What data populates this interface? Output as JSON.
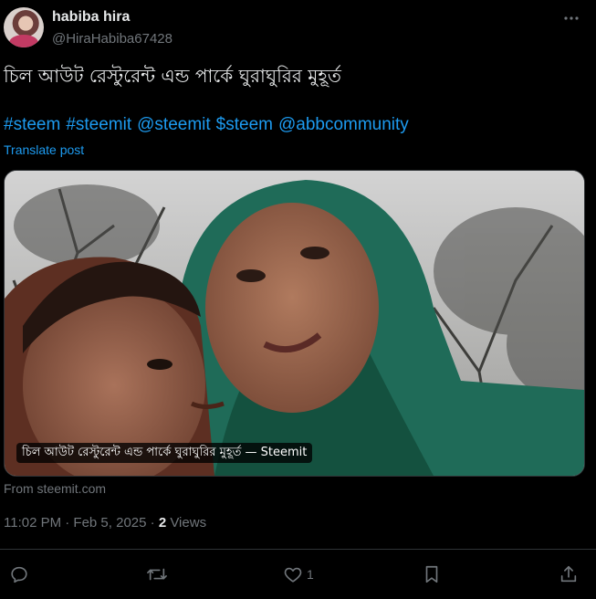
{
  "author": {
    "display_name": "habiba hira",
    "handle": "@HiraHabiba67428"
  },
  "post": {
    "text": "চিল আউট রেস্টুরেন্ট এন্ড পার্কে ঘুরাঘুরির মুহূর্ত",
    "tags": [
      "#steem",
      "#steemit",
      "@steemit",
      "$steem",
      "@abbcommunity"
    ],
    "translate_label": "Translate post"
  },
  "card": {
    "caption": "চিল আউট রেস্টুরেন্ট এন্ড পার্কে ঘুরাঘুরির মুহূর্ত — Steemit",
    "source": "From steemit.com"
  },
  "meta": {
    "timestamp": "11:02 PM · Feb 5, 2025 · ",
    "views_count": "2",
    "views_label": " Views"
  },
  "actions": {
    "reply_count": "",
    "repost_count": "",
    "like_count": "1",
    "bookmark_count": "",
    "share_count": ""
  },
  "colors": {
    "background": "#000000",
    "text_primary": "#e7e9ea",
    "text_secondary": "#71767b",
    "link": "#1d9bf0",
    "border": "#2f3336"
  }
}
